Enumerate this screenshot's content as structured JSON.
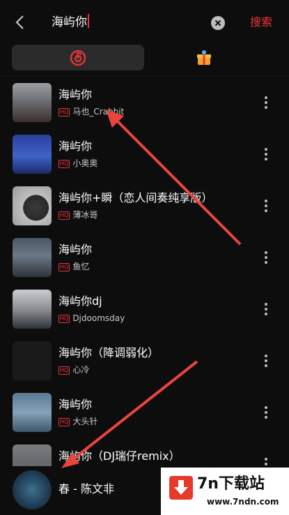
{
  "search": {
    "query": "海屿你",
    "action_label": "搜索"
  },
  "tabs": [
    {
      "icon": "netease-music-icon",
      "active": true
    },
    {
      "icon": "gift-box-icon",
      "active": false
    }
  ],
  "colors": {
    "accent": "#e8343b",
    "background": "#0d0d0d",
    "secondary_text": "#c9c9c9"
  },
  "results": [
    {
      "title": "海屿你",
      "quality": "HQ",
      "artist": "马也_Crabbit"
    },
    {
      "title": "海屿你",
      "quality": "HQ",
      "artist": "小奥奥"
    },
    {
      "title": "海屿你+瞬（恋人间奏纯享版）",
      "quality": "HQ",
      "artist": "薄冰哥"
    },
    {
      "title": "海屿你",
      "quality": "HQ",
      "artist": "鱼忆"
    },
    {
      "title": "海屿你dj",
      "quality": "HQ",
      "artist": "Djdoomsday"
    },
    {
      "title": "海屿你（降调弱化）",
      "quality": "HQ",
      "artist": "心冷"
    },
    {
      "title": "海屿你",
      "quality": "HQ",
      "artist": "大头针"
    },
    {
      "title": "海屿你（DJ瑞仔remix）",
      "quality": "",
      "artist": ""
    }
  ],
  "now_playing": {
    "title": "春 - 陈文非"
  },
  "watermark": {
    "name": "7n下载站",
    "url": "www.7ndn.com"
  }
}
